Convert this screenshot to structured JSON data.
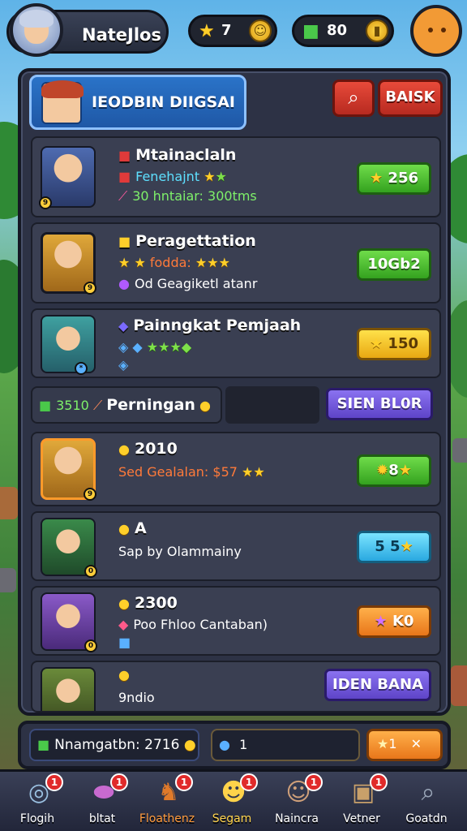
{
  "topbar": {
    "player_name": "NateJlos",
    "stars": "7",
    "gems": "80"
  },
  "panel": {
    "title": "IEODBIN DIIGSAI",
    "back_label": "BAISK"
  },
  "rows": [
    {
      "title": "Mtainaclaln",
      "line1": "Fenehajnt",
      "line2": "30 hntaiar: 300tms",
      "action": "256"
    },
    {
      "title": "Peragettation",
      "line1": "fodda:",
      "line2": "Od Geagiketl atanr",
      "action": "10Gb2"
    },
    {
      "title": "Painngkat Pemjaah",
      "action": "150"
    }
  ],
  "mid_strip": {
    "count": "3510",
    "label": "Perningan",
    "button": "SIEN BL0R"
  },
  "lower_rows": [
    {
      "title": "2010",
      "line1": "Sed Gealalan: $57",
      "action": "8"
    },
    {
      "title": "A",
      "line1": "Sap by Olammainy",
      "action": "5 5"
    },
    {
      "title": "2300",
      "line1": "Poo Fhloo Cantaban)",
      "action": "K0"
    },
    {
      "title": "9ndio",
      "action": "IDEN BANA"
    }
  ],
  "status": {
    "left": "Nnamgatbn: 2716",
    "mid": "1",
    "right": "1"
  },
  "tabs": [
    {
      "label": "Flogih",
      "badge": "1"
    },
    {
      "label": "bltat",
      "badge": "1"
    },
    {
      "label": "Floathenz",
      "badge": "1"
    },
    {
      "label": "Segam",
      "badge": "1"
    },
    {
      "label": "Naincra",
      "badge": "1"
    },
    {
      "label": "Vetner",
      "badge": "1"
    },
    {
      "label": "Goatdn"
    }
  ]
}
